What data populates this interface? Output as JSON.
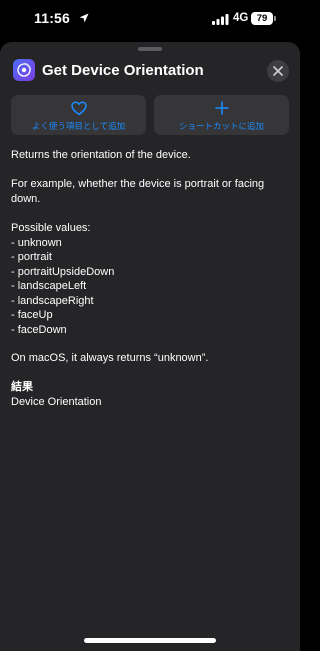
{
  "status": {
    "time": "11:56",
    "network": "4G",
    "battery": "79"
  },
  "header": {
    "title": "Get Device Orientation"
  },
  "actions": {
    "favorite_label": "よく使う項目として追加",
    "shortcut_label": "ショートカットに追加"
  },
  "description": {
    "summary": "Returns the orientation of the device.",
    "example_1": "For example, whether the device is portrait or facing",
    "example_2": "down.",
    "possible_heading": "Possible values:",
    "values": [
      "- unknown",
      "- portrait",
      "- portraitUpsideDown",
      "- landscapeLeft",
      "- landscapeRight",
      "- faceUp",
      "- faceDown"
    ],
    "macos_note": "On macOS, it always returns “unknown”.",
    "result_heading": "結果",
    "result_value": "Device Orientation"
  },
  "colors": {
    "accent": "#1a8cff",
    "sheet": "#252527",
    "button": "#363638"
  }
}
